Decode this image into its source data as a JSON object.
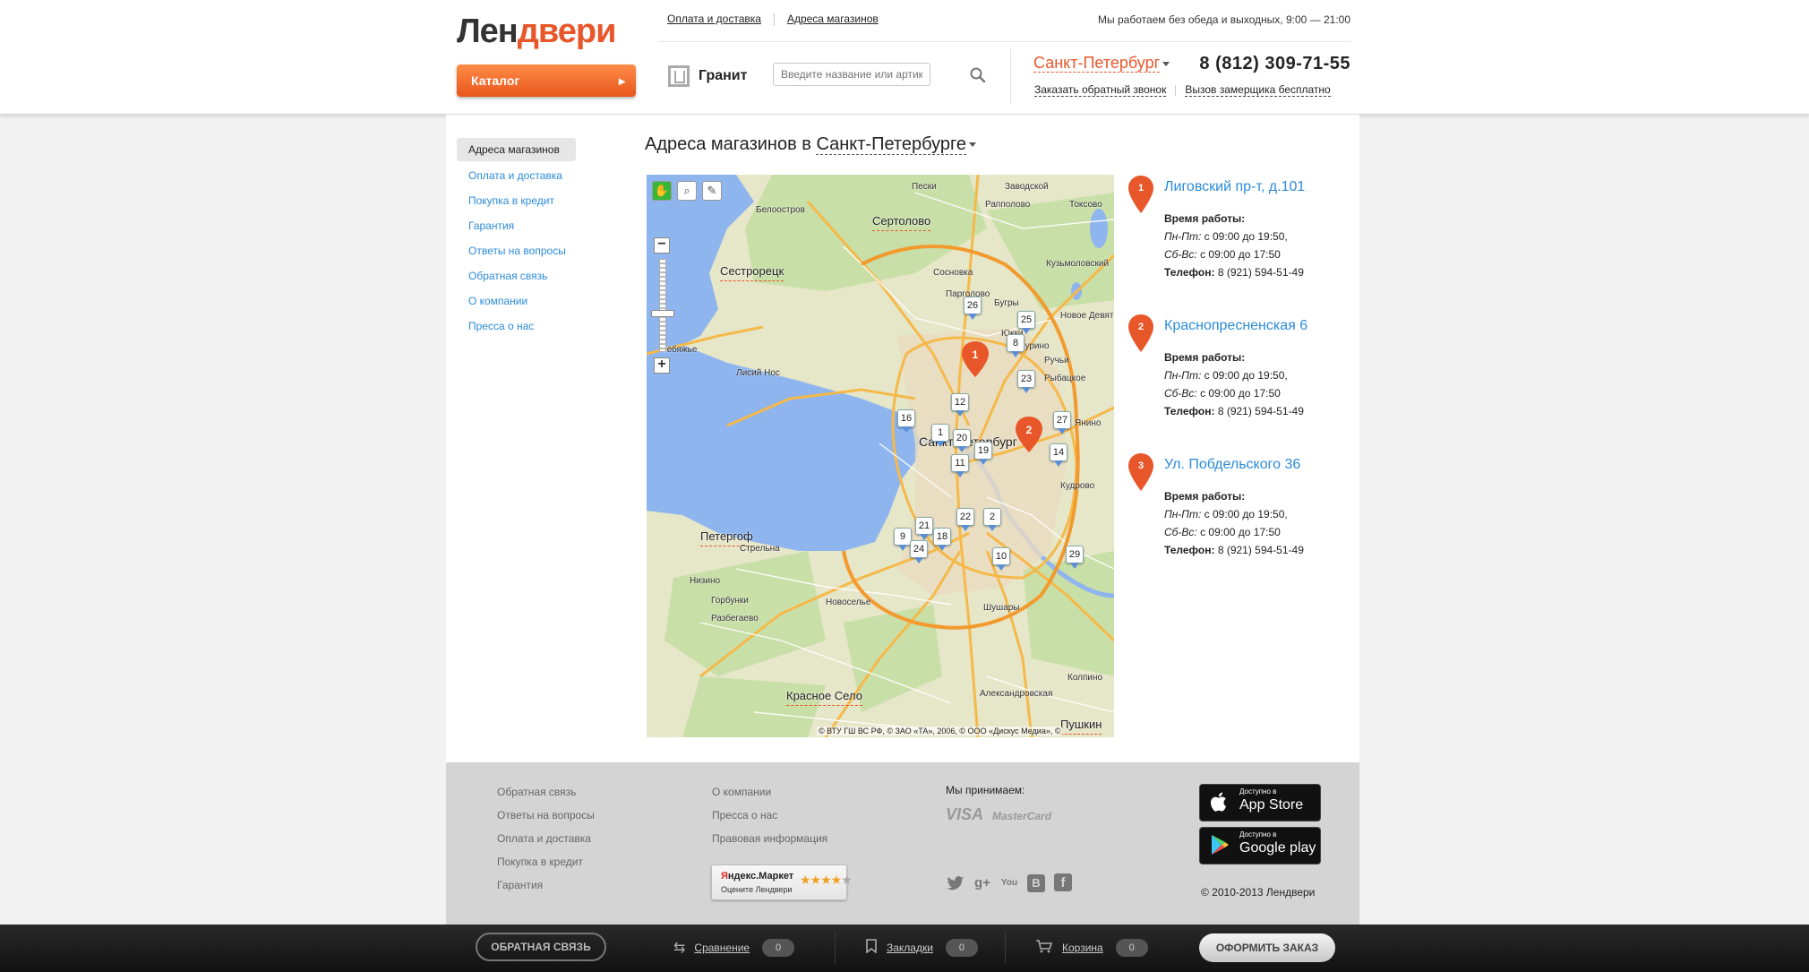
{
  "header": {
    "logo_part1": "Лен",
    "logo_part2": "двери",
    "catalog_label": "Каталог",
    "nav": [
      "Оплата и доставка",
      "Адреса магазинов"
    ],
    "work_hours": "Мы работаем без обеда и выходных, 9:00 — 21:00",
    "brand": "Гранит",
    "search_placeholder": "Введите название или артикул",
    "city": "Санкт-Петербург",
    "phone": "8 (812) 309-71-55",
    "callback_link": "Заказать обратный звонок",
    "measurer_link": "Вызов замерщика бесплатно"
  },
  "sidebar": {
    "items": [
      "Адреса магазинов",
      "Оплата и доставка",
      "Покупка в кредит",
      "Гарантия",
      "Ответы на вопросы",
      "Обратная связь",
      "О компании",
      "Пресса о нас"
    ]
  },
  "main": {
    "title_prefix": "Адреса магазинов в",
    "title_city": "Санкт-Петербурге"
  },
  "map": {
    "labels": [
      "Белоостров",
      "Сертолово",
      "Сестрорецк",
      "Парголово",
      "Бугры",
      "Токсово",
      "Кузьмоловский",
      "Лисий Нос",
      "Санкт-Петербург",
      "Петергоф",
      "Красное Село",
      "Пушкин",
      "Горбунки",
      "Низино",
      "Разбегаево",
      "Колпино",
      "Новое Девяткино",
      "Рыбацкое",
      "Кудрово",
      "Шушары",
      "Александровская",
      "Новоселье",
      "Сосновка",
      "Янино",
      "Стрельна",
      "Пески",
      "Заводской",
      "Рапполово",
      "Лебяжье",
      "Юкки",
      "Мурино",
      "Ручьи"
    ],
    "copyright": "© ВТУ ГШ ВС РФ, © ЗАО «ТА», 2006, © ООО «Дискус Медиа», ©",
    "markers": [
      "26",
      "25",
      "8",
      "23",
      "12",
      "16",
      "1",
      "20",
      "11",
      "19",
      "27",
      "14",
      "22",
      "2",
      "21",
      "9",
      "18",
      "24",
      "10",
      "29"
    ],
    "big_pins": [
      "1",
      "2"
    ],
    "colors": {
      "water": "#8fb5ef",
      "land": "#e6e6c9",
      "forest": "#c9dfa8",
      "road_major": "#f5b94a",
      "road_minor": "#ffffff",
      "pin": "#e8572a",
      "marker_tail": "#5a8fd8"
    }
  },
  "stores": [
    {
      "num": "1",
      "name": "Лиговский пр-т, д.101",
      "hours_title": "Время работы:",
      "weekdays_label": "Пн-Пт:",
      "weekdays_hours": "с 09:00 до 19:50,",
      "weekend_label": "Сб-Вс:",
      "weekend_hours": "с 09:00 до 17:50",
      "phone_label": "Телефон:",
      "phone": "8 (921) 594-51-49"
    },
    {
      "num": "2",
      "name": "Краснопресненская 6",
      "hours_title": "Время работы:",
      "weekdays_label": "Пн-Пт:",
      "weekdays_hours": "с 09:00 до 19:50,",
      "weekend_label": "Сб-Вс:",
      "weekend_hours": "с 09:00 до 17:50",
      "phone_label": "Телефон:",
      "phone": "8 (921) 594-51-49"
    },
    {
      "num": "3",
      "name": "Ул. Побдельского 36",
      "hours_title": "Время работы:",
      "weekdays_label": "Пн-Пт:",
      "weekdays_hours": "с 09:00 до 19:50,",
      "weekend_label": "Сб-Вс:",
      "weekend_hours": "с 09:00 до 17:50",
      "phone_label": "Телефон:",
      "phone": "8 (921) 594-51-49"
    }
  ],
  "footer": {
    "col1": [
      "Обратная связь",
      "Ответы на вопросы",
      "Оплата и доставка",
      "Покупка в кредит",
      "Гарантия"
    ],
    "col2": [
      "О компании",
      "Пресса о нас",
      "Правовая информация"
    ],
    "we_accept": "Мы принимаем:",
    "visa": "VISA",
    "mastercard": "MasterCard",
    "ym_title_y": "Я",
    "ym_title_rest": "ндекс.Маркет",
    "ym_sub": "Оцените Лендвери",
    "ym_rating": 4,
    "appstore_small": "Доступно в",
    "appstore_big": "App Store",
    "gplay_small": "Доступно в",
    "gplay_big": "Google play",
    "copyright": "© 2010-2013 Лендвери",
    "social": [
      "twitter-icon",
      "googleplus-icon",
      "youtube-icon",
      "vkontakte-icon",
      "facebook-icon"
    ]
  },
  "bottombar": {
    "feedback": "ОБРАТНАЯ СВЯЗЬ",
    "compare": "Сравнение",
    "compare_count": "0",
    "bookmarks": "Закладки",
    "bookmarks_count": "0",
    "cart": "Корзина",
    "cart_count": "0",
    "order": "ОФОРМИТЬ ЗАКАЗ"
  }
}
